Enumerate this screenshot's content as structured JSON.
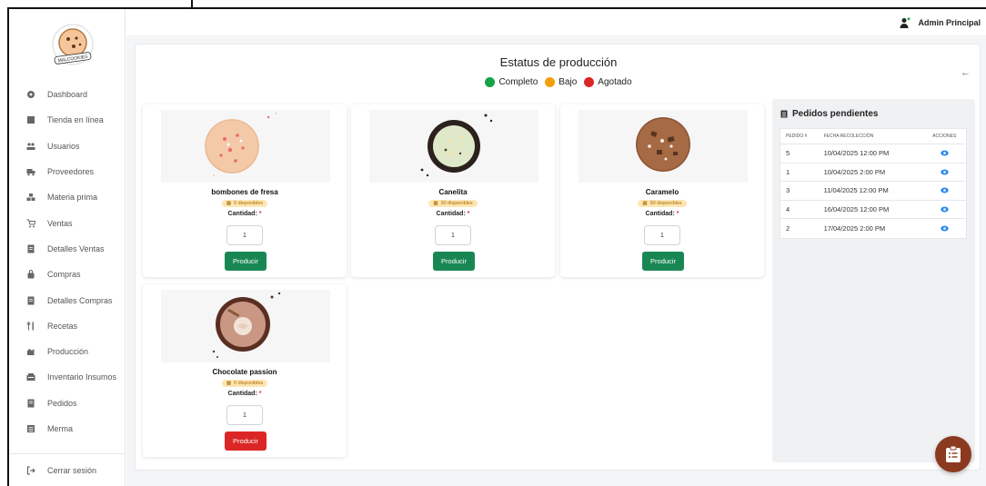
{
  "app": {
    "logo_text": "MALCOOKIES"
  },
  "sidebar": {
    "items": [
      {
        "label": "Dashboard",
        "icon": "dashboard-icon"
      },
      {
        "label": "Tienda en línea",
        "icon": "store-icon"
      },
      {
        "label": "Usuarios",
        "icon": "users-icon"
      },
      {
        "label": "Proveedores",
        "icon": "truck-icon"
      },
      {
        "label": "Materia prima",
        "icon": "boxes-icon"
      },
      {
        "label": "Ventas",
        "icon": "cart-icon"
      },
      {
        "label": "Detalles Ventas",
        "icon": "file-icon"
      },
      {
        "label": "Compras",
        "icon": "bag-icon"
      },
      {
        "label": "Detalles Compras",
        "icon": "file-icon"
      },
      {
        "label": "Recetas",
        "icon": "utensils-icon"
      },
      {
        "label": "Producción",
        "icon": "production-icon"
      },
      {
        "label": "Inventario Insumos",
        "icon": "inventory-icon"
      },
      {
        "label": "Pedidos",
        "icon": "orders-icon"
      },
      {
        "label": "Merma",
        "icon": "list-icon"
      }
    ],
    "logout_label": "Cerrar sesión"
  },
  "topbar": {
    "user_name": "Admin Principal"
  },
  "main": {
    "title": "Estatus de producción",
    "back_icon": "←",
    "legend": [
      {
        "label": "Completo",
        "color": "#16a34a"
      },
      {
        "label": "Bajo",
        "color": "#f59e0b"
      },
      {
        "label": "Agotado",
        "color": "#dc2626"
      }
    ]
  },
  "products": [
    {
      "name": "bombones de fresa",
      "stock": "0 disponibles",
      "qty_label": "Cantidad:",
      "qty_value": "1",
      "button": "Producir",
      "button_color": "#198754"
    },
    {
      "name": "Canelita",
      "stock": "30 disponibles",
      "qty_label": "Cantidad:",
      "qty_value": "1",
      "button": "Producir",
      "button_color": "#198754"
    },
    {
      "name": "Caramelo",
      "stock": "90 disponibles",
      "qty_label": "Cantidad:",
      "qty_value": "1",
      "button": "Producir",
      "button_color": "#198754"
    },
    {
      "name": "Chocolate passion",
      "stock": "0 disponibles",
      "qty_label": "Cantidad:",
      "qty_value": "1",
      "button": "Producir",
      "button_color": "#dc2626"
    }
  ],
  "orders": {
    "title": "Pedidos pendientes",
    "headers": [
      "PEDIDO #",
      "FECHA RECOLECCIÓN",
      "ACCIONES"
    ],
    "rows": [
      {
        "id": "5",
        "date": "10/04/2025 12:00 PM"
      },
      {
        "id": "1",
        "date": "10/04/2025 2:00 PM"
      },
      {
        "id": "3",
        "date": "11/04/2025 12:00 PM"
      },
      {
        "id": "4",
        "date": "16/04/2025 12:00 PM"
      },
      {
        "id": "2",
        "date": "17/04/2025 2:00 PM"
      }
    ]
  }
}
